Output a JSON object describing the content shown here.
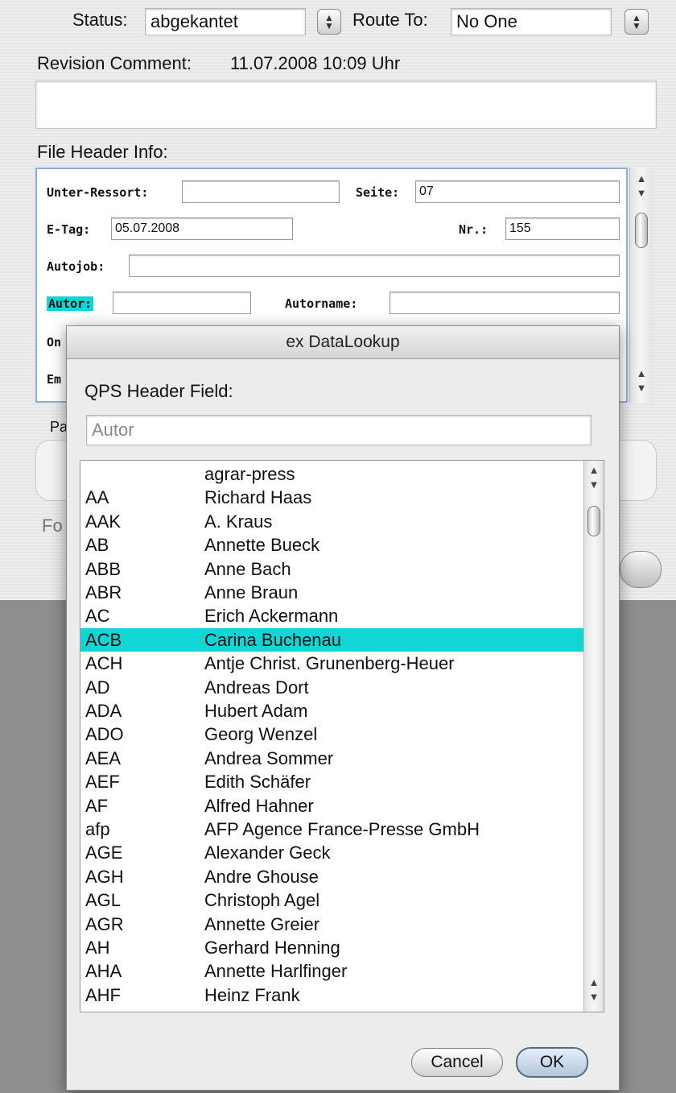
{
  "top": {
    "status_label": "Status:",
    "status_value": "abgekantet",
    "route_label": "Route To:",
    "route_value": "No One",
    "revision_label": "Revision Comment:",
    "revision_datetime": "11.07.2008  10:09 Uhr",
    "file_header_label": "File Header Info:"
  },
  "header_fields": {
    "unter_ressort_label": "Unter-Ressort:",
    "unter_ressort_value": "",
    "seite_label": "Seite:",
    "seite_value": "07",
    "etag_label": "E-Tag:",
    "etag_value": "05.07.2008",
    "nr_label": "Nr.:",
    "nr_value": "155",
    "autojob_label": "Autojob:",
    "autojob_value": "",
    "autor_label": "Autor:",
    "autor_value": "",
    "autorname_label": "Autorname:",
    "autorname_value": "",
    "partial_on": "On",
    "partial_em": "Em"
  },
  "background": {
    "partial_pa": "Pa",
    "partial_fo": "Fo"
  },
  "dialog": {
    "title": "ex DataLookup",
    "field_label": "QPS Header Field:",
    "field_value": "Autor",
    "selected_index": 7,
    "items": [
      {
        "code": "",
        "name": "agrar-press"
      },
      {
        "code": "AA",
        "name": "Richard Haas"
      },
      {
        "code": "AAK",
        "name": "A. Kraus"
      },
      {
        "code": "AB",
        "name": "Annette Bueck"
      },
      {
        "code": "ABB",
        "name": "Anne Bach"
      },
      {
        "code": "ABR",
        "name": "Anne Braun"
      },
      {
        "code": "AC",
        "name": "Erich Ackermann"
      },
      {
        "code": "ACB",
        "name": "Carina Buchenau"
      },
      {
        "code": "ACH",
        "name": "Antje Christ. Grunenberg-Heuer"
      },
      {
        "code": "AD",
        "name": "Andreas Dort"
      },
      {
        "code": "ADA",
        "name": "Hubert Adam"
      },
      {
        "code": "ADO",
        "name": "Georg Wenzel"
      },
      {
        "code": "AEA",
        "name": "Andrea Sommer"
      },
      {
        "code": "AEF",
        "name": "Edith Schäfer"
      },
      {
        "code": "AF",
        "name": "Alfred Hahner"
      },
      {
        "code": "afp",
        "name": "AFP Agence France-Presse GmbH"
      },
      {
        "code": "AGE",
        "name": "Alexander Geck"
      },
      {
        "code": "AGH",
        "name": "Andre Ghouse"
      },
      {
        "code": "AGL",
        "name": "Christoph Agel"
      },
      {
        "code": "AGR",
        "name": "Annette Greier"
      },
      {
        "code": "AH",
        "name": "Gerhard Henning"
      },
      {
        "code": "AHA",
        "name": "Annette Harlfinger"
      },
      {
        "code": "AHF",
        "name": "Heinz Frank"
      }
    ],
    "cancel_label": "Cancel",
    "ok_label": "OK"
  },
  "colors": {
    "selection": "#12d6d6",
    "focus_ring": "#8ab0da"
  }
}
